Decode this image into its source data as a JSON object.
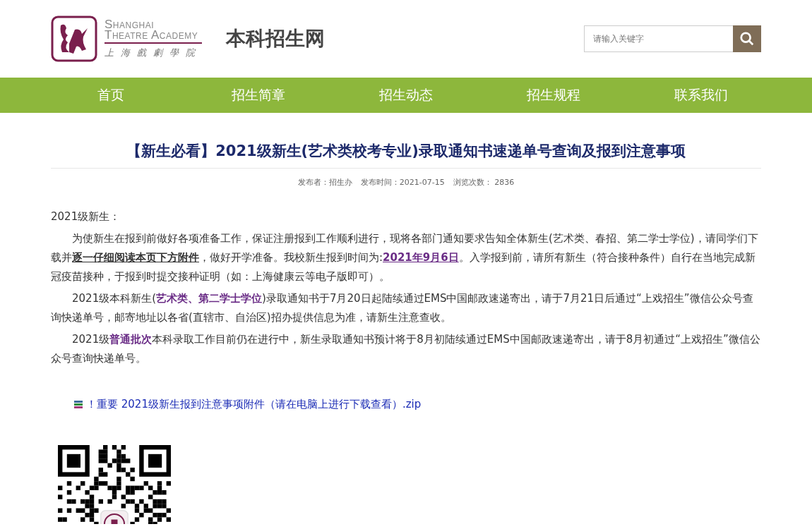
{
  "header": {
    "logo": {
      "english_line_1": "Shanghai",
      "english_line_2": "Theatre Academy",
      "chinese": "上海戲劇學院"
    },
    "site_title": "本科招生网",
    "search": {
      "placeholder": "请输入关键字"
    }
  },
  "nav": [
    {
      "label": "首页",
      "selected": false
    },
    {
      "label": "招生简章",
      "selected": false
    },
    {
      "label": "招生动态",
      "selected": false
    },
    {
      "label": "招生规程",
      "selected": false
    },
    {
      "label": "联系我们",
      "selected": false
    }
  ],
  "article": {
    "title": "【新生必看】2021级新生(艺术类校考专业)录取通知书速递单号查询及报到注意事项",
    "meta": {
      "publisher_label": "发布者：",
      "publisher": "招生办",
      "time_label": "发布时间：",
      "time": "2021-07-15",
      "views_label": "浏览次数：",
      "views": "2836"
    },
    "greeting": "2021级新生：",
    "paragraphs": [
      [
        {
          "kind": "plain",
          "text": "为使新生在报到前做好各项准备工作，保证注册报到工作顺利进行，现将各部门通知要求告知全体新生(艺术类、春招、第二学士学位)，请同学们下载并"
        },
        {
          "kind": "underlined",
          "text": "逐一仔细阅读本页下方附件"
        },
        {
          "kind": "plain",
          "text": "，做好开学准备。我校新生报到时间为:"
        },
        {
          "kind": "highlight-underlined",
          "text": "2021年9月6日"
        },
        {
          "kind": "plain",
          "text": "。入学报到前，请所有新生（符合接种条件）自行在当地完成新冠疫苗接种，于报到时提交接种证明（如：上海健康云等电子版即可）。"
        }
      ],
      [
        {
          "kind": "plain",
          "text": "2021级本科新生("
        },
        {
          "kind": "highlight",
          "text": "艺术类、第二学士学位"
        },
        {
          "kind": "plain",
          "text": ")录取通知书于7月20日起陆续通过EMS中国邮政速递寄出，请于7月21日后通过“上戏招生”微信公众号查询快递单号，邮寄地址以各省(直辖市、自治区)招办提供信息为准，请新生注意查收。"
        }
      ],
      [
        {
          "kind": "plain",
          "text": "2021级"
        },
        {
          "kind": "highlight",
          "text": "普通批次"
        },
        {
          "kind": "plain",
          "text": "本科录取工作目前仍在进行中，新生录取通知书预计将于8月初陆续通过EMS中国邮政速递寄出，请于8月初通过“上戏招生”微信公众号查询快递单号。"
        }
      ]
    ],
    "attachment": "！重要 2021级新生报到注意事项附件（请在电脑上进行下载查看）.zip"
  }
}
